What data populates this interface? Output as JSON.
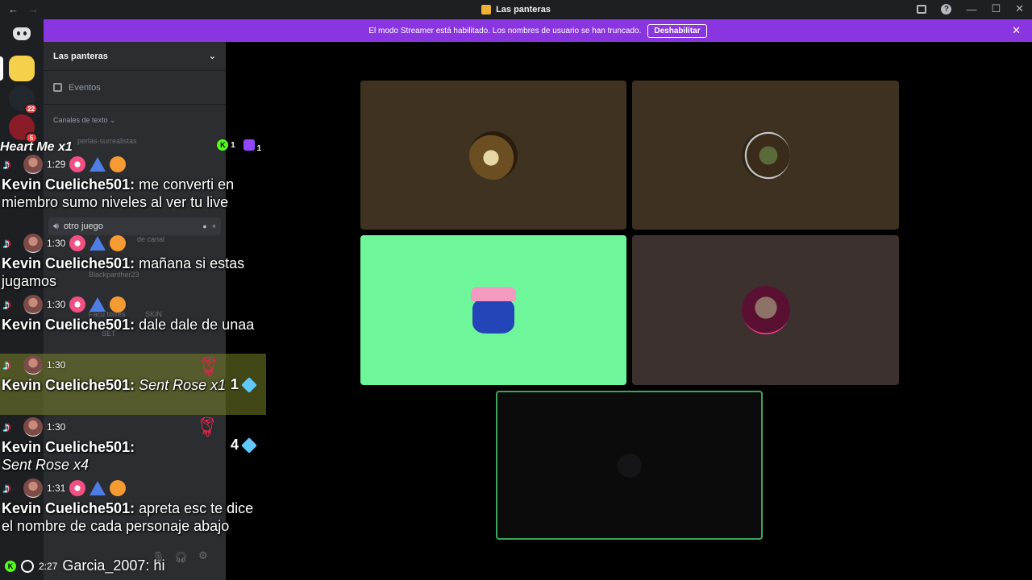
{
  "window": {
    "title": "Las panteras",
    "back": "←",
    "forward": "→",
    "minimize": "—",
    "maximize": "☐",
    "close": "✕"
  },
  "banner": {
    "text": "El modo Streamer está habilitado. Los nombres de usuario se han truncado.",
    "button": "Deshabilitar",
    "close": "✕"
  },
  "sidebar": {
    "server_name": "Las panteras",
    "events_label": "Eventos",
    "category_label": "Canales de texto",
    "channel_ghost": "perlas-surrealistas",
    "voice_channel": "otro juego",
    "ghost_names": [
      "Blackpanther23",
      "Facu torres",
      "SKIN",
      "SET",
      "de canal"
    ]
  },
  "servers": [
    {
      "badge": ""
    },
    {
      "badge": "22"
    },
    {
      "badge": "5"
    }
  ],
  "overlay": {
    "header_text": "Heart Me x1",
    "kick_count": "1",
    "twitch_count": "1",
    "messages": [
      {
        "time": "1:29",
        "user": "Kevin Cueliche501:",
        "text": "me converti en miembro sumo niveles al ver tu live",
        "gift": false
      },
      {
        "time": "1:30",
        "user": "Kevin Cueliche501:",
        "text": "mañana si estas jugamos",
        "gift": false
      },
      {
        "time": "1:30",
        "user": "Kevin Cueliche501:",
        "text": "dale dale de unaa",
        "gift": false
      },
      {
        "time": "1:30",
        "user": "Kevin Cueliche501:",
        "text": "Sent Rose x1",
        "gift": true,
        "count": "1"
      },
      {
        "time": "1:30",
        "user": "Kevin Cueliche501:",
        "text": "Sent Rose x4",
        "gift": true,
        "count": "4"
      },
      {
        "time": "1:31",
        "user": "Kevin Cueliche501:",
        "text": "apreta esc te dice el nombre de cada personaje abajo",
        "gift": false
      }
    ],
    "bottom": {
      "time": "2:27",
      "text": "Garcia_2007: hi"
    }
  },
  "colors": {
    "banner": "#8a36e0",
    "speaking": "#3ba55c",
    "tile_green": "#6ef79a"
  }
}
